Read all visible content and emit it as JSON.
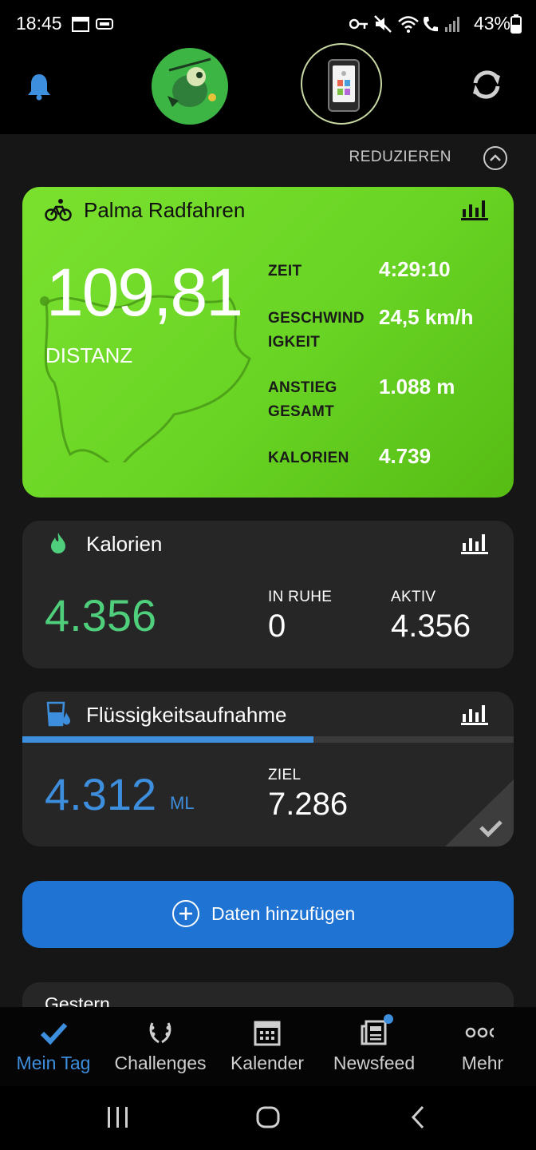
{
  "status_bar": {
    "time": "18:45",
    "battery": "43%"
  },
  "header": {
    "left_icon": "bell-icon",
    "right_icon": "sync-icon"
  },
  "reduce_label": "REDUZIEREN",
  "activity": {
    "title": "Palma Radfahren",
    "distance": "109,81",
    "distance_label": "DISTANZ",
    "stats": [
      {
        "label_l1": "ZEIT",
        "label_l2": "",
        "value": "4:29:10"
      },
      {
        "label_l1": "GESCHWIND",
        "label_l2": "IGKEIT",
        "value": "24,5 km/h"
      },
      {
        "label_l1": "ANSTIEG",
        "label_l2": "GESAMT",
        "value": "1.088 m"
      },
      {
        "label_l1": "KALORIEN",
        "label_l2": "",
        "value": "4.739"
      }
    ]
  },
  "calories": {
    "title": "Kalorien",
    "total": "4.356",
    "rest_label": "IN RUHE",
    "rest_value": "0",
    "active_label": "AKTIV",
    "active_value": "4.356"
  },
  "fluid": {
    "title": "Flüssigkeitsaufnahme",
    "amount": "4.312",
    "unit": "ML",
    "goal_label": "ZIEL",
    "goal_value": "7.286",
    "progress": 0.592
  },
  "add_data_label": "Daten hinzufügen",
  "yesterday_label": "Gestern",
  "bottom_nav": [
    {
      "label": "Mein Tag",
      "active": true
    },
    {
      "label": "Challenges",
      "active": false
    },
    {
      "label": "Kalender",
      "active": false
    },
    {
      "label": "Newsfeed",
      "active": false
    },
    {
      "label": "Mehr",
      "active": false
    }
  ],
  "colors": {
    "accent_green": "#6cd626",
    "accent_blue": "#3e8ede",
    "calorie_green": "#4fcf7c",
    "button_blue": "#1f73d3"
  }
}
